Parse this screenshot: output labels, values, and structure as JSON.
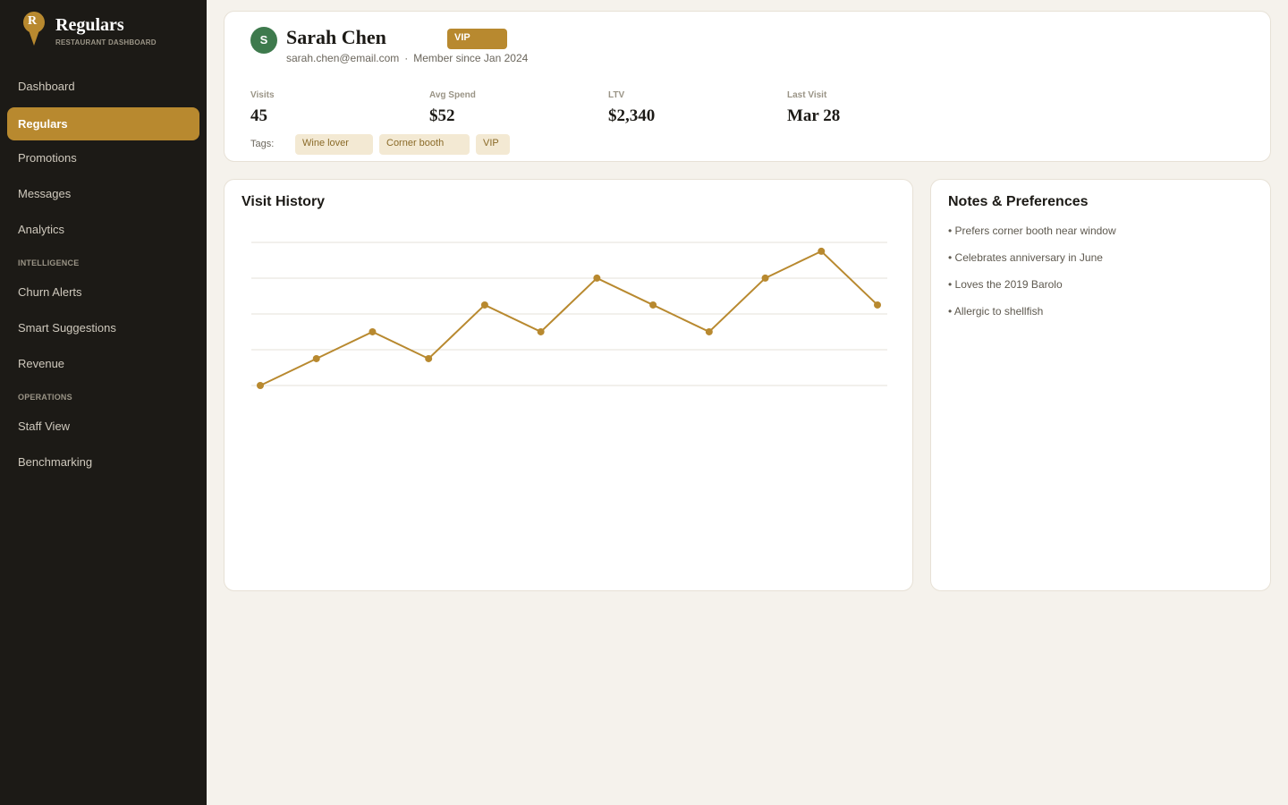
{
  "brand": {
    "letter": "R",
    "title": "Regulars",
    "subtitle": "RESTAURANT DASHBOARD",
    "color": "#b8892f"
  },
  "nav": {
    "items": [
      {
        "label": "Dashboard",
        "active": false
      },
      {
        "label": "Regulars",
        "active": true
      },
      {
        "label": "Promotions",
        "active": false
      },
      {
        "label": "Messages",
        "active": false
      },
      {
        "label": "Analytics",
        "active": false
      }
    ],
    "section_intelligence": "INTELLIGENCE",
    "intelligence_items": [
      {
        "label": "Churn Alerts"
      },
      {
        "label": "Smart Suggestions"
      },
      {
        "label": "Revenue"
      }
    ],
    "section_operations": "OPERATIONS",
    "operations_items": [
      {
        "label": "Staff View"
      },
      {
        "label": "Benchmarking"
      }
    ]
  },
  "profile": {
    "avatar_initial": "S",
    "avatar_color": "#3e7a4d",
    "name": "Sarah Chen",
    "badge": "VIP",
    "email": "sarah.chen@email.com",
    "separator": "·",
    "member_since": "Member since Jan 2024",
    "stats": [
      {
        "label": "Visits",
        "value": "45"
      },
      {
        "label": "Avg Spend",
        "value": "$52"
      },
      {
        "label": "LTV",
        "value": "$2,340"
      },
      {
        "label": "Last Visit",
        "value": "Mar 28"
      }
    ],
    "tags_label": "Tags:",
    "tags": [
      "Wine lover",
      "Corner booth",
      "VIP"
    ]
  },
  "history": {
    "title": "Visit History"
  },
  "chart_data": {
    "type": "line",
    "title": "",
    "xlabel": "",
    "ylabel": "",
    "x": [
      1,
      2,
      3,
      4,
      5,
      6,
      7,
      8,
      9,
      10,
      11,
      12
    ],
    "series": [
      {
        "values": [
          0,
          1,
          2,
          1,
          3,
          2,
          4,
          3,
          2,
          4,
          5,
          3
        ],
        "color": "#b8892f"
      }
    ],
    "ylim": [
      0,
      5.33
    ],
    "grid": true,
    "gridlines": 5,
    "markers": true
  },
  "notes": {
    "title": "Notes & Preferences",
    "items": [
      "• Prefers corner booth near window",
      "• Celebrates anniversary in June",
      "• Loves the 2019 Barolo",
      "• Allergic to shellfish"
    ]
  }
}
